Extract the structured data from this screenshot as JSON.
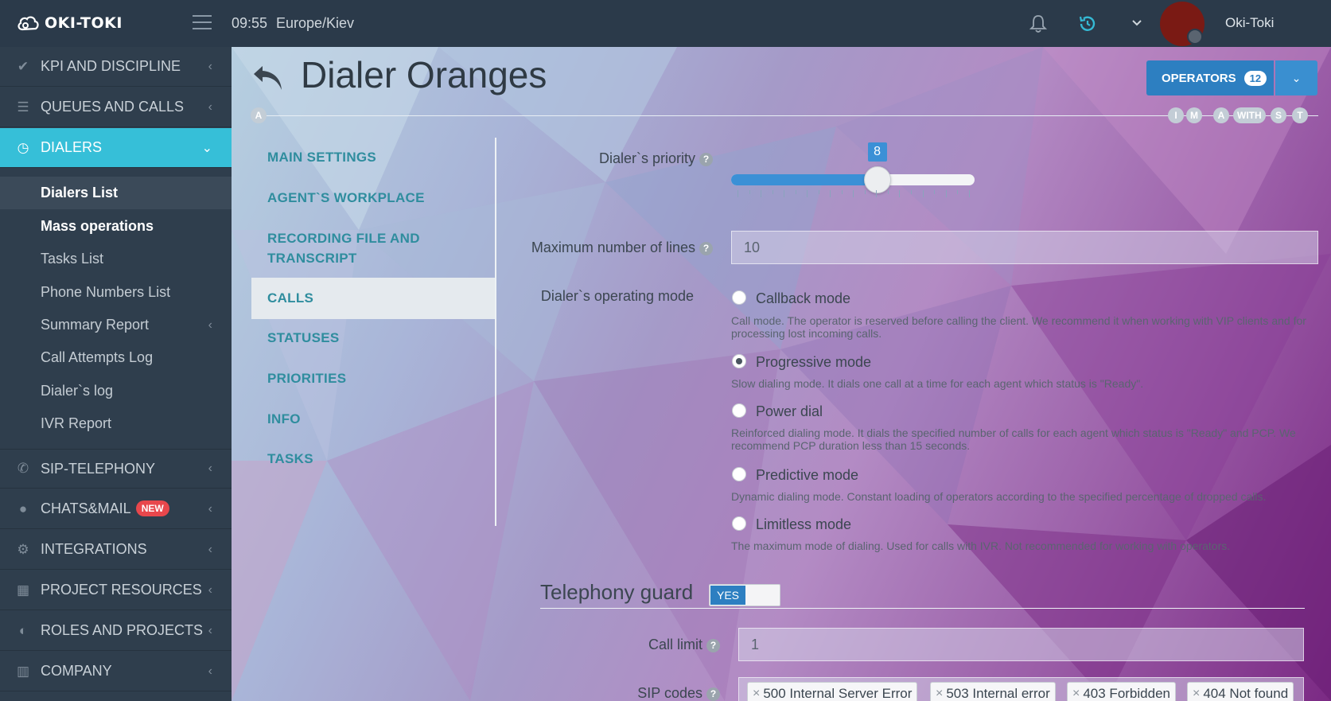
{
  "topbar": {
    "logo_text": "OKI-TOKI",
    "time": "09:55",
    "timezone": "Europe/Kiev",
    "user_name": "Oki-Toki"
  },
  "sidebar": {
    "items": [
      {
        "label": "KPI AND DISCIPLINE",
        "icon": "check-icon"
      },
      {
        "label": "QUEUES AND CALLS",
        "icon": "list-icon"
      },
      {
        "label": "DIALERS",
        "icon": "clock-icon"
      },
      {
        "label": "SIP-TELEPHONY",
        "icon": "phone-icon"
      },
      {
        "label": "CHATS&MAIL",
        "icon": "chat-icon",
        "badge": "NEW"
      },
      {
        "label": "INTEGRATIONS",
        "icon": "gears-icon"
      },
      {
        "label": "PROJECT RESOURCES",
        "icon": "grid-icon"
      },
      {
        "label": "ROLES AND PROJECTS",
        "icon": "toggle-icon"
      },
      {
        "label": "COMPANY",
        "icon": "bar-chart-icon"
      }
    ],
    "dialer_sub": [
      {
        "label": "Dialers List"
      },
      {
        "label": "Mass operations"
      },
      {
        "label": "Tasks List"
      },
      {
        "label": "Phone Numbers List"
      },
      {
        "label": "Summary Report"
      },
      {
        "label": "Call Attempts Log"
      },
      {
        "label": "Dialer`s log"
      },
      {
        "label": "IVR Report"
      }
    ]
  },
  "page": {
    "title": "Dialer Oranges",
    "operators_label": "OPERATORS",
    "operators_count": "12",
    "left_chip": "A",
    "chips": [
      "I",
      "M",
      "A",
      "WITH",
      "S",
      "T"
    ]
  },
  "menu": {
    "items": [
      {
        "label": "MAIN SETTINGS"
      },
      {
        "label": "AGENT`S WORKPLACE"
      },
      {
        "label": "RECORDING FILE AND TRANSCRIPT"
      },
      {
        "label": "CALLS"
      },
      {
        "label": "STATUSES"
      },
      {
        "label": "PRIORITIES"
      },
      {
        "label": "INFO"
      },
      {
        "label": "TASKS"
      }
    ]
  },
  "form": {
    "priority_label": "Dialer`s priority",
    "priority_value": 8,
    "priority_max": 10,
    "max_lines_label": "Maximum number of lines",
    "max_lines_value": "10",
    "mode_label": "Dialer`s operating mode",
    "modes": [
      {
        "label": "Callback mode",
        "desc": "Call mode. The operator is reserved before calling the client. We recommend it when working with VIP clients and for processing lost incoming calls.",
        "selected": false
      },
      {
        "label": "Progressive mode",
        "desc": "Slow dialing mode. It dials one call at a time for each agent which status is \"Ready\".",
        "selected": true
      },
      {
        "label": "Power dial",
        "desc": "Reinforced dialing mode. It dials the specified number of calls for each agent which status is \"Ready\" and PCP. We recommend PCP duration less than 15 seconds.",
        "selected": false
      },
      {
        "label": "Predictive mode",
        "desc": "Dynamic dialing mode. Constant loading of operators according to the specified percentage of dropped calls.",
        "selected": false
      },
      {
        "label": "Limitless mode",
        "desc": "The maximum mode of dialing. Used for calls with IVR. Not recommended for working with operators.",
        "selected": false
      }
    ],
    "guard_title": "Telephony guard",
    "guard_toggle": "YES",
    "call_limit_label": "Call limit",
    "call_limit_value": "1",
    "sip_codes_label": "SIP codes",
    "sip_codes": [
      "500 Internal Server Error",
      "503 Internal error",
      "403 Forbidden",
      "404 Not found"
    ]
  }
}
